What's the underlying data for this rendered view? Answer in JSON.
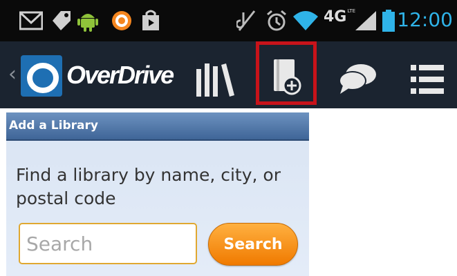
{
  "status_bar": {
    "time": "12:00",
    "network": "4G",
    "network_sub": "LTE",
    "icons": [
      "gmail-icon",
      "tag-icon",
      "android-icon",
      "app-icon",
      "shopping-bag-icon",
      "mute-icon",
      "alarm-icon",
      "wifi-icon",
      "signal-icon",
      "battery-icon"
    ]
  },
  "action_bar": {
    "back": "‹",
    "logo_text": "OverDrive",
    "icons": [
      "bookshelf-icon",
      "add-library-icon",
      "chat-icon",
      "menu-icon"
    ],
    "highlight_color": "#c8131a"
  },
  "panel": {
    "title": "Add a Library",
    "description": "Find a library by name, city, or postal code",
    "search_placeholder": "Search",
    "search_value": "",
    "search_button": "Search"
  },
  "colors": {
    "accent_time": "#2fb3e8",
    "button_orange": "#f07a00",
    "header_blue": "#3f6597"
  }
}
